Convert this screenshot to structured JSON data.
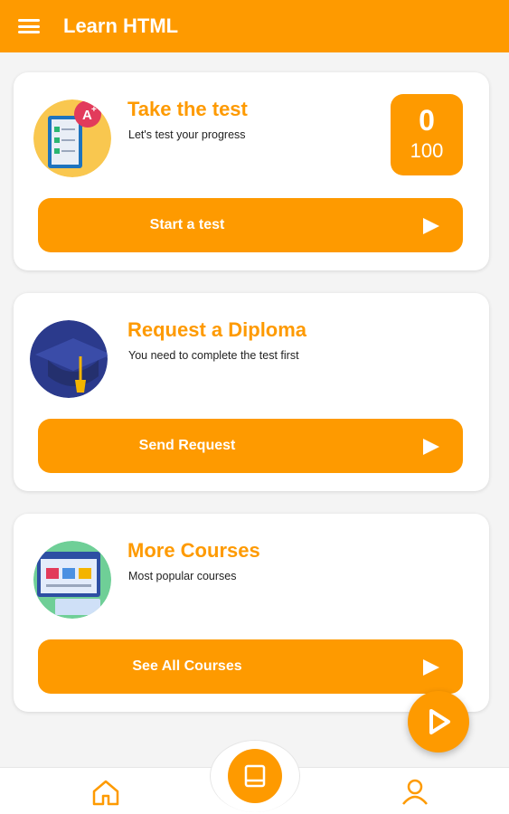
{
  "app": {
    "title": "Learn HTML"
  },
  "cards": [
    {
      "title": "Take the test",
      "subtitle": "Let's test your progress",
      "button": "Start a test",
      "score": {
        "value": "0",
        "max": "100"
      }
    },
    {
      "title": "Request a Diploma",
      "subtitle": "You need to complete the test first",
      "button": "Send Request"
    },
    {
      "title": "More Courses",
      "subtitle": "Most popular courses",
      "button": "See All Courses"
    }
  ],
  "icons": {
    "menu": "menu-icon",
    "play": "play-icon",
    "home": "home-icon",
    "book": "book-icon",
    "user": "user-icon"
  },
  "colors": {
    "accent": "#fe9a00",
    "background": "#f4f4f4"
  }
}
